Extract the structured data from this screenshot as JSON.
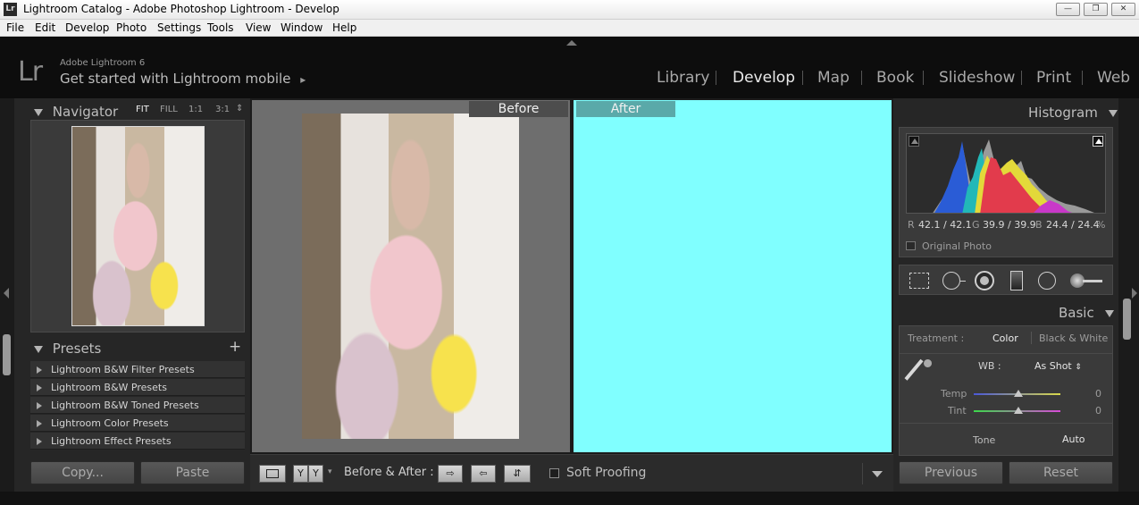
{
  "window": {
    "title": "Lightroom Catalog - Adobe Photoshop Lightroom - Develop",
    "app_icon": "Lr",
    "controls": [
      "minimize-icon",
      "restore-icon",
      "close-icon"
    ]
  },
  "menu": [
    "File",
    "Edit",
    "Develop",
    "Photo",
    "Settings",
    "Tools",
    "View",
    "Window",
    "Help"
  ],
  "identity": {
    "logo": "Lr",
    "brand": "Adobe Lightroom 6",
    "mobile": "Get started with Lightroom mobile",
    "mobile_arrow": "▸"
  },
  "modules": [
    "Library",
    "Develop",
    "Map",
    "Book",
    "Slideshow",
    "Print",
    "Web"
  ],
  "active_module": "Develop",
  "navigator": {
    "title": "Navigator",
    "zoom": [
      "FIT",
      "FILL",
      "1:1",
      "3:1"
    ],
    "zoom_arrow": "⇕",
    "active_zoom": "FIT"
  },
  "presets": {
    "title": "Presets",
    "add": "+",
    "items": [
      "Lightroom B&W Filter Presets",
      "Lightroom B&W Presets",
      "Lightroom B&W Toned Presets",
      "Lightroom Color Presets",
      "Lightroom Effect Presets"
    ]
  },
  "left_buttons": {
    "copy": "Copy...",
    "paste": "Paste"
  },
  "compare": {
    "before": "Before",
    "after": "After",
    "after_color": "#80ffff"
  },
  "toolbar": {
    "yy": [
      "Y",
      "Y"
    ],
    "before_after_label": "Before & After :",
    "soft_proofing": "Soft Proofing"
  },
  "histogram": {
    "title": "Histogram",
    "r_label": "R",
    "r": "42.1 / 42.1",
    "g_label": "G",
    "g": "39.9 / 39.9",
    "b_label": "B",
    "b": "24.4 / 24.4",
    "unit": "%",
    "original_photo": "Original Photo"
  },
  "basic": {
    "title": "Basic",
    "treatment_label": "Treatment :",
    "treatment_color": "Color",
    "treatment_bw": "Black & White",
    "wb_label": "WB :",
    "wb_value": "As Shot",
    "wb_arrows": "⇕",
    "temp_label": "Temp",
    "temp_value": "0",
    "tint_label": "Tint",
    "tint_value": "0",
    "tone_label": "Tone",
    "auto": "Auto"
  },
  "right_buttons": {
    "previous": "Previous",
    "reset": "Reset"
  }
}
